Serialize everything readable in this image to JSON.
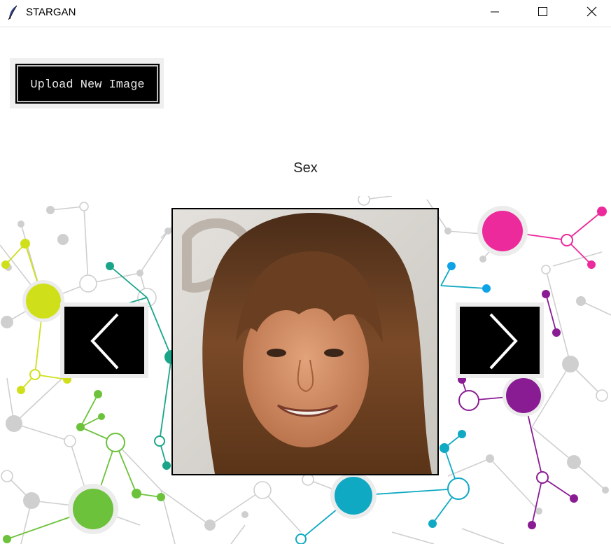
{
  "window": {
    "title": "STARGAN",
    "app_icon": "feather-icon",
    "controls": [
      "minimize-icon",
      "maximize-icon",
      "close-icon"
    ]
  },
  "toolbar": {
    "upload_label": "Upload New Image"
  },
  "attribute": {
    "label": "Sex"
  },
  "navigation": {
    "prev_icon": "chevron-left-icon",
    "next_icon": "chevron-right-icon"
  },
  "colors": {
    "lime": "#cfe01b",
    "green": "#6cc23a",
    "teal": "#1aa58a",
    "cyan": "#10a9c3",
    "blue": "#0ea3e6",
    "magenta": "#ec2a9c",
    "purple": "#8a1c93",
    "grey": "#c8c8c8"
  }
}
